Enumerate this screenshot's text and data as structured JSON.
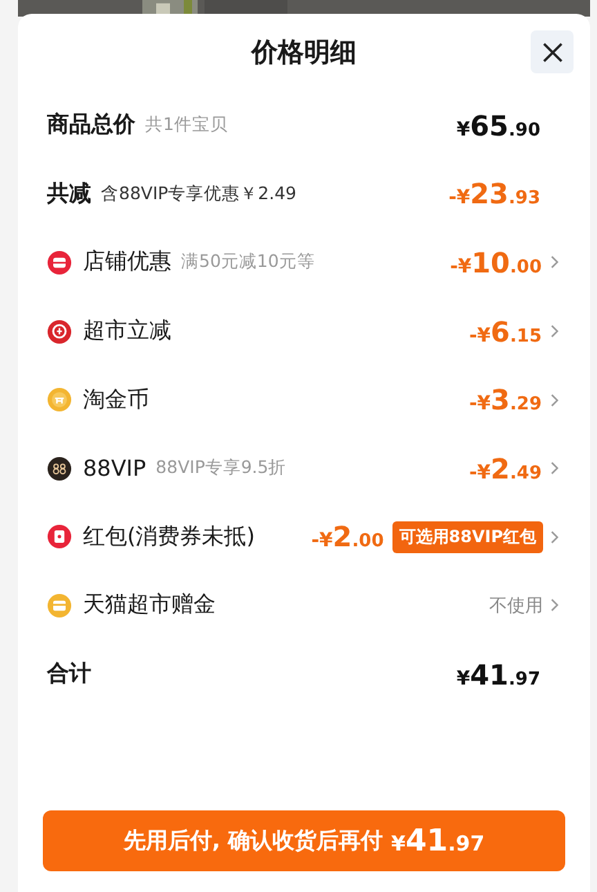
{
  "sheet": {
    "title": "价格明细"
  },
  "rows": [
    {
      "kind": "summary",
      "label": "商品总价",
      "note": "共1件宝贝",
      "amount": "¥65.90"
    },
    {
      "kind": "reduction",
      "label": "共减",
      "note": "含88VIP专享优惠￥2.49",
      "amount": "-¥23.93"
    },
    {
      "kind": "discount",
      "label": "店铺优惠",
      "note": "满50元减10元等",
      "amount": "-¥10.00"
    },
    {
      "kind": "discount",
      "label": "超市立减",
      "amount": "-¥6.15"
    },
    {
      "kind": "discount",
      "label": "淘金币",
      "amount": "-¥3.29"
    },
    {
      "kind": "discount",
      "label": "88VIP",
      "note": "88VIP专享9.5折",
      "amount": "-¥2.49"
    },
    {
      "kind": "discount",
      "label": "红包(消费券未抵)",
      "amount": "-¥2.00",
      "badge": "可选用88VIP红包"
    },
    {
      "kind": "option",
      "label": "天猫超市赠金",
      "value": "不使用"
    },
    {
      "kind": "summary",
      "label": "合计",
      "amount": "¥41.97"
    }
  ],
  "pay_button": {
    "label": "先用后付, 确认收货后再付",
    "amount": "¥41.97"
  }
}
